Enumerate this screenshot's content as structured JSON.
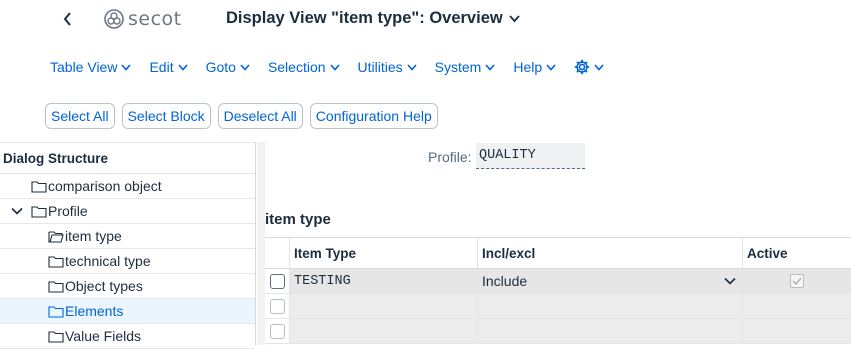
{
  "header": {
    "logo_text": "secot",
    "title": "Display View \"item type\": Overview"
  },
  "menu": [
    {
      "label": "Table View"
    },
    {
      "label": "Edit"
    },
    {
      "label": "Goto"
    },
    {
      "label": "Selection"
    },
    {
      "label": "Utilities"
    },
    {
      "label": "System"
    },
    {
      "label": "Help"
    }
  ],
  "toolbar": {
    "select_all": "Select All",
    "select_block": "Select Block",
    "deselect_all": "Deselect All",
    "config_help": "Configuration Help"
  },
  "tree": {
    "header": "Dialog Structure",
    "items": [
      {
        "label": "comparison object"
      },
      {
        "label": "Profile"
      },
      {
        "label": "item type"
      },
      {
        "label": "technical type"
      },
      {
        "label": "Object types"
      },
      {
        "label": "Elements"
      },
      {
        "label": "Value Fields"
      }
    ]
  },
  "profile": {
    "label": "Profile:",
    "value": "QUALITY"
  },
  "section": {
    "title": "item type"
  },
  "table": {
    "columns": [
      "Item Type",
      "Incl/excl",
      "Active"
    ],
    "rows": [
      {
        "item_type": "TESTING",
        "incl_excl": "Include",
        "active": true
      },
      {
        "item_type": "",
        "incl_excl": "",
        "active": false
      },
      {
        "item_type": "",
        "incl_excl": "",
        "active": false
      }
    ]
  },
  "colors": {
    "link_blue": "#0064d9",
    "text_dark": "#1d2d3e",
    "selected_row_bg": "#ebf5fe"
  }
}
